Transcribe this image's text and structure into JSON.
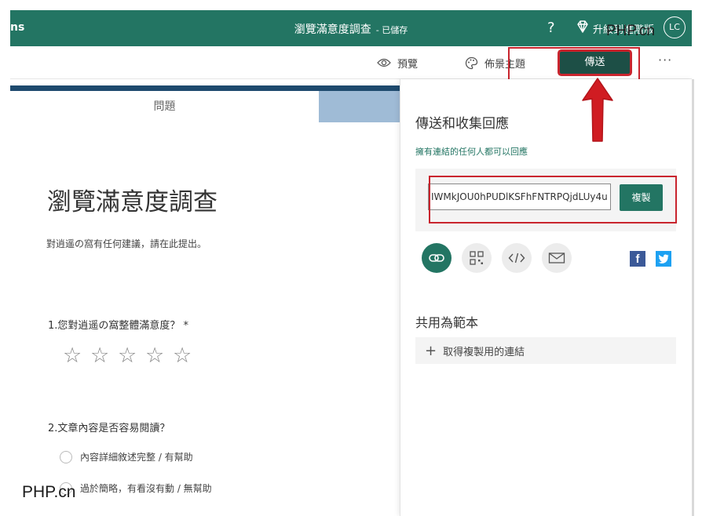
{
  "topbar": {
    "app_name": "ns",
    "doc_title": "瀏覽滿意度調查",
    "saved_status": "- 已儲存",
    "help": "?",
    "upgrade_label": "升級到進階版",
    "avatar_initials": "LC",
    "watermark": "PHP.cn"
  },
  "toolbar": {
    "preview_label": "預覽",
    "theme_label": "佈景主題",
    "send_label": "傳送",
    "more_label": "···"
  },
  "form": {
    "tab_questions": "問題",
    "title": "瀏覽滿意度調查",
    "description": "對逍遥の窩有任何建議，請在此提出。",
    "q1": "1.您對逍遥の窩整體滿意度？ *",
    "stars": [
      "☆",
      "☆",
      "☆",
      "☆",
      "☆"
    ],
    "q2": "2.文章內容是否容易閱讀？",
    "q2_options": [
      "內容詳細敘述完整 / 有幫助",
      "過於簡略，有看沒有動 / 無幫助"
    ],
    "watermark": "PHP.cn"
  },
  "send_panel": {
    "title": "傳送和收集回應",
    "subtitle": "擁有連結的任何人都可以回應",
    "link_value": "IWMkJOU0hPUDlKSFhFNTRPQjdLUy4u",
    "copy_label": "複製",
    "facebook_letter": "f",
    "template_title": "共用為範本",
    "template_link_label": "取得複製用的連結",
    "template_plus": "+"
  },
  "colors": {
    "brand": "#237563",
    "send_button": "#1d4f46",
    "highlight": "#c9252e",
    "facebook": "#3b5998",
    "twitter": "#1da1f2"
  },
  "icons": {
    "preview": "eye-icon",
    "theme": "palette-icon",
    "upgrade": "diamond-icon",
    "share": [
      "link-icon",
      "qr-code-icon",
      "embed-code-icon",
      "email-icon"
    ],
    "social": [
      "facebook-icon",
      "twitter-icon"
    ]
  }
}
